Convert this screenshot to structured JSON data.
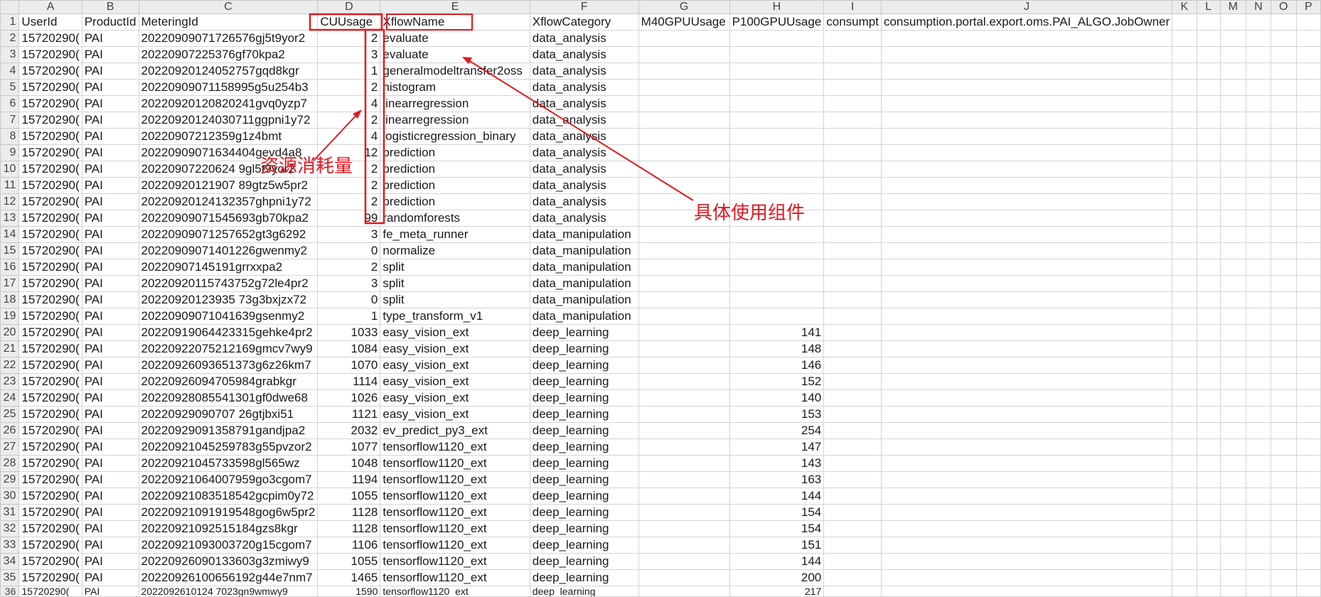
{
  "columns": [
    "A",
    "B",
    "C",
    "D",
    "E",
    "F",
    "G",
    "H",
    "I",
    "J",
    "K",
    "L",
    "M",
    "N",
    "O",
    "P"
  ],
  "headers": [
    "UserId",
    "ProductId",
    "MeteringId",
    "CUUsage",
    "XflowName",
    "XflowCategory",
    "M40GPUUsage",
    "P100GPUUsage",
    "consumpt",
    "consumption.portal.export.oms.PAI_ALGO.JobOwner",
    "",
    "",
    "",
    "",
    "",
    ""
  ],
  "rows": [
    [
      "15720290(",
      "PAI",
      "20220909071726576gj5t9yor2",
      "2",
      "evaluate",
      "data_analysis",
      "",
      ""
    ],
    [
      "15720290(",
      "PAI",
      "20220907225376gf70kpa2",
      "3",
      "evaluate",
      "data_analysis",
      "",
      ""
    ],
    [
      "15720290(",
      "PAI",
      "20220920124052757gqd8kgr",
      "1",
      "generalmodeltransfer2oss",
      "data_analysis",
      "",
      ""
    ],
    [
      "15720290(",
      "PAI",
      "20220909071158995g5u254b3",
      "2",
      "histogram",
      "data_analysis",
      "",
      ""
    ],
    [
      "15720290(",
      "PAI",
      "20220920120820241gvq0yzp7",
      "4",
      "linearregression",
      "data_analysis",
      "",
      ""
    ],
    [
      "15720290(",
      "PAI",
      "20220920124030711ggpni1y72",
      "2",
      "linearregression",
      "data_analysis",
      "",
      ""
    ],
    [
      "15720290(",
      "PAI",
      "20220907212359g1z4bmt",
      "4",
      "logisticregression_binary",
      "data_analysis",
      "",
      ""
    ],
    [
      "15720290(",
      "PAI",
      "20220909071634404gevd4a8",
      "12",
      "prediction",
      "data_analysis",
      "",
      ""
    ],
    [
      "15720290(",
      "PAI",
      "20220907220624 9gl5t9yor2",
      "2",
      "prediction",
      "data_analysis",
      "",
      ""
    ],
    [
      "15720290(",
      "PAI",
      "20220920121907 89gtz5w5pr2",
      "2",
      "prediction",
      "data_analysis",
      "",
      ""
    ],
    [
      "15720290(",
      "PAI",
      "20220920124132357ghpni1y72",
      "2",
      "prediction",
      "data_analysis",
      "",
      ""
    ],
    [
      "15720290(",
      "PAI",
      "20220909071545693gb70kpa2",
      "99",
      "randomforests",
      "data_analysis",
      "",
      ""
    ],
    [
      "15720290(",
      "PAI",
      "20220909071257652gt3g6292",
      "3",
      "fe_meta_runner",
      "data_manipulation",
      "",
      ""
    ],
    [
      "15720290(",
      "PAI",
      "20220909071401226gwenmy2",
      "0",
      "normalize",
      "data_manipulation",
      "",
      ""
    ],
    [
      "15720290(",
      "PAI",
      "20220907145191grrxxpa2",
      "2",
      "split",
      "data_manipulation",
      "",
      ""
    ],
    [
      "15720290(",
      "PAI",
      "20220920115743752g72le4pr2",
      "3",
      "split",
      "data_manipulation",
      "",
      ""
    ],
    [
      "15720290(",
      "PAI",
      "20220920123935 73g3bxjzx72",
      "0",
      "split",
      "data_manipulation",
      "",
      ""
    ],
    [
      "15720290(",
      "PAI",
      "20220909071041639gsenmy2",
      "1",
      "type_transform_v1",
      "data_manipulation",
      "",
      ""
    ],
    [
      "15720290(",
      "PAI",
      "20220919064423315gehke4pr2",
      "1033",
      "easy_vision_ext",
      "deep_learning",
      "",
      "141"
    ],
    [
      "15720290(",
      "PAI",
      "20220922075212169gmcv7wy9",
      "1084",
      "easy_vision_ext",
      "deep_learning",
      "",
      "148"
    ],
    [
      "15720290(",
      "PAI",
      "20220926093651373g6z26km7",
      "1070",
      "easy_vision_ext",
      "deep_learning",
      "",
      "146"
    ],
    [
      "15720290(",
      "PAI",
      "20220926094705984grabkgr",
      "1114",
      "easy_vision_ext",
      "deep_learning",
      "",
      "152"
    ],
    [
      "15720290(",
      "PAI",
      "20220928085541301gf0dwe68",
      "1026",
      "easy_vision_ext",
      "deep_learning",
      "",
      "140"
    ],
    [
      "15720290(",
      "PAI",
      "20220929090707 26gtjbxi51",
      "1121",
      "easy_vision_ext",
      "deep_learning",
      "",
      "153"
    ],
    [
      "15720290(",
      "PAI",
      "20220929091358791gandjpa2",
      "2032",
      "ev_predict_py3_ext",
      "deep_learning",
      "",
      "254"
    ],
    [
      "15720290(",
      "PAI",
      "20220921045259783g55pvzor2",
      "1077",
      "tensorflow1120_ext",
      "deep_learning",
      "",
      "147"
    ],
    [
      "15720290(",
      "PAI",
      "20220921045733598gl565wz",
      "1048",
      "tensorflow1120_ext",
      "deep_learning",
      "",
      "143"
    ],
    [
      "15720290(",
      "PAI",
      "20220921064007959go3cgom7",
      "1194",
      "tensorflow1120_ext",
      "deep_learning",
      "",
      "163"
    ],
    [
      "15720290(",
      "PAI",
      "20220921083518542gcpim0y72",
      "1055",
      "tensorflow1120_ext",
      "deep_learning",
      "",
      "144"
    ],
    [
      "15720290(",
      "PAI",
      "20220921091919548gog6w5pr2",
      "1128",
      "tensorflow1120_ext",
      "deep_learning",
      "",
      "154"
    ],
    [
      "15720290(",
      "PAI",
      "20220921092515184gzs8kgr",
      "1128",
      "tensorflow1120_ext",
      "deep_learning",
      "",
      "154"
    ],
    [
      "15720290(",
      "PAI",
      "20220921093003720g15cgom7",
      "1106",
      "tensorflow1120_ext",
      "deep_learning",
      "",
      "151"
    ],
    [
      "15720290(",
      "PAI",
      "20220926090133603g3zmiwy9",
      "1055",
      "tensorflow1120_ext",
      "deep_learning",
      "",
      "144"
    ],
    [
      "15720290(",
      "PAI",
      "20220926100656192g44e7nm7",
      "1465",
      "tensorflow1120_ext",
      "deep_learning",
      "",
      "200"
    ],
    [
      "15720290(",
      "PAI",
      "2022092610124 7023gn9wmwy9",
      "1590",
      "tensorflow1120_ext",
      "deep_learning",
      "",
      "217"
    ]
  ],
  "annotations": {
    "resource_label": "资源消耗量",
    "component_label": "具体使用组件",
    "color": "#e0191f"
  },
  "grid_color": "#d4d4d4",
  "header_bg": "#ececec"
}
